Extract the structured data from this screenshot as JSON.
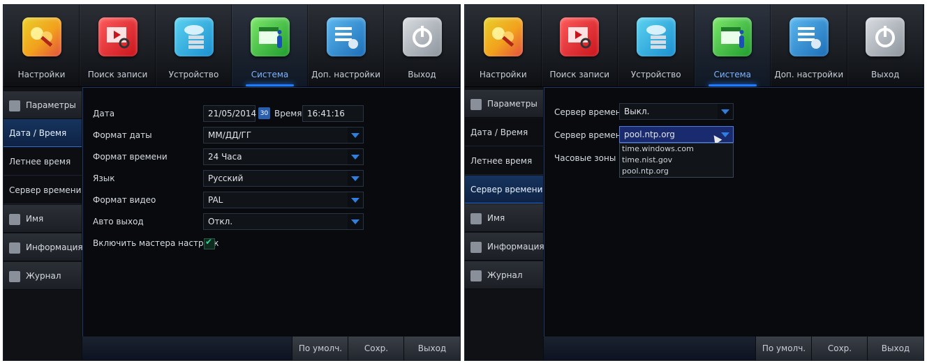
{
  "tabs": [
    {
      "label": "Настройки",
      "icon": "settings-icon"
    },
    {
      "label": "Поиск записи",
      "icon": "record-search-icon"
    },
    {
      "label": "Устройство",
      "icon": "device-storage-icon"
    },
    {
      "label": "Система",
      "icon": "system-calendar-icon"
    },
    {
      "label": "Доп. настройки",
      "icon": "advanced-settings-icon"
    },
    {
      "label": "Выход",
      "icon": "power-icon"
    }
  ],
  "active_tab": "Система",
  "sidebar": {
    "items": [
      {
        "label": "Параметры",
        "icon": "gear-icon"
      },
      {
        "label": "Дата / Время"
      },
      {
        "label": "Летнее время"
      },
      {
        "label": "Сервер времени"
      },
      {
        "label": "Имя",
        "icon": "person-icon"
      },
      {
        "label": "Информация",
        "icon": "info-icon"
      },
      {
        "label": "Журнал",
        "icon": "log-icon"
      }
    ]
  },
  "left": {
    "selected_sidebar": "Дата / Время",
    "fields": {
      "date_label": "Дата",
      "date_value": "21/05/2014",
      "cal_day": "30",
      "time_label": "Время",
      "time_value": "16:41:16",
      "date_format_label": "Формат даты",
      "date_format_value": "ММ/ДД/ГГ",
      "time_format_label": "Формат времени",
      "time_format_value": "24 Часа",
      "language_label": "Язык",
      "language_value": "Русский",
      "video_format_label": "Формат видео",
      "video_format_value": "PAL",
      "auto_exit_label": "Авто выход",
      "auto_exit_value": "Откл.",
      "wizard_label": "Включить мастера настроек",
      "wizard_checked": true
    }
  },
  "right": {
    "selected_sidebar": "Сервер времени",
    "fields": {
      "ntp_label": "Сервер времени",
      "ntp_value": "Выкл.",
      "ntp_server_label": "Сервер времени",
      "ntp_server_value": "pool.ntp.org",
      "timezone_label": "Часовые зоны",
      "dropdown_options": [
        "time.windows.com",
        "time.nist.gov",
        "pool.ntp.org"
      ]
    }
  },
  "buttons": {
    "default": "По умолч.",
    "save": "Сохр.",
    "exit": "Выход"
  },
  "colors": {
    "accent": "#1e7bff",
    "selected_bg": "#16345e",
    "background": "#080a0d"
  }
}
